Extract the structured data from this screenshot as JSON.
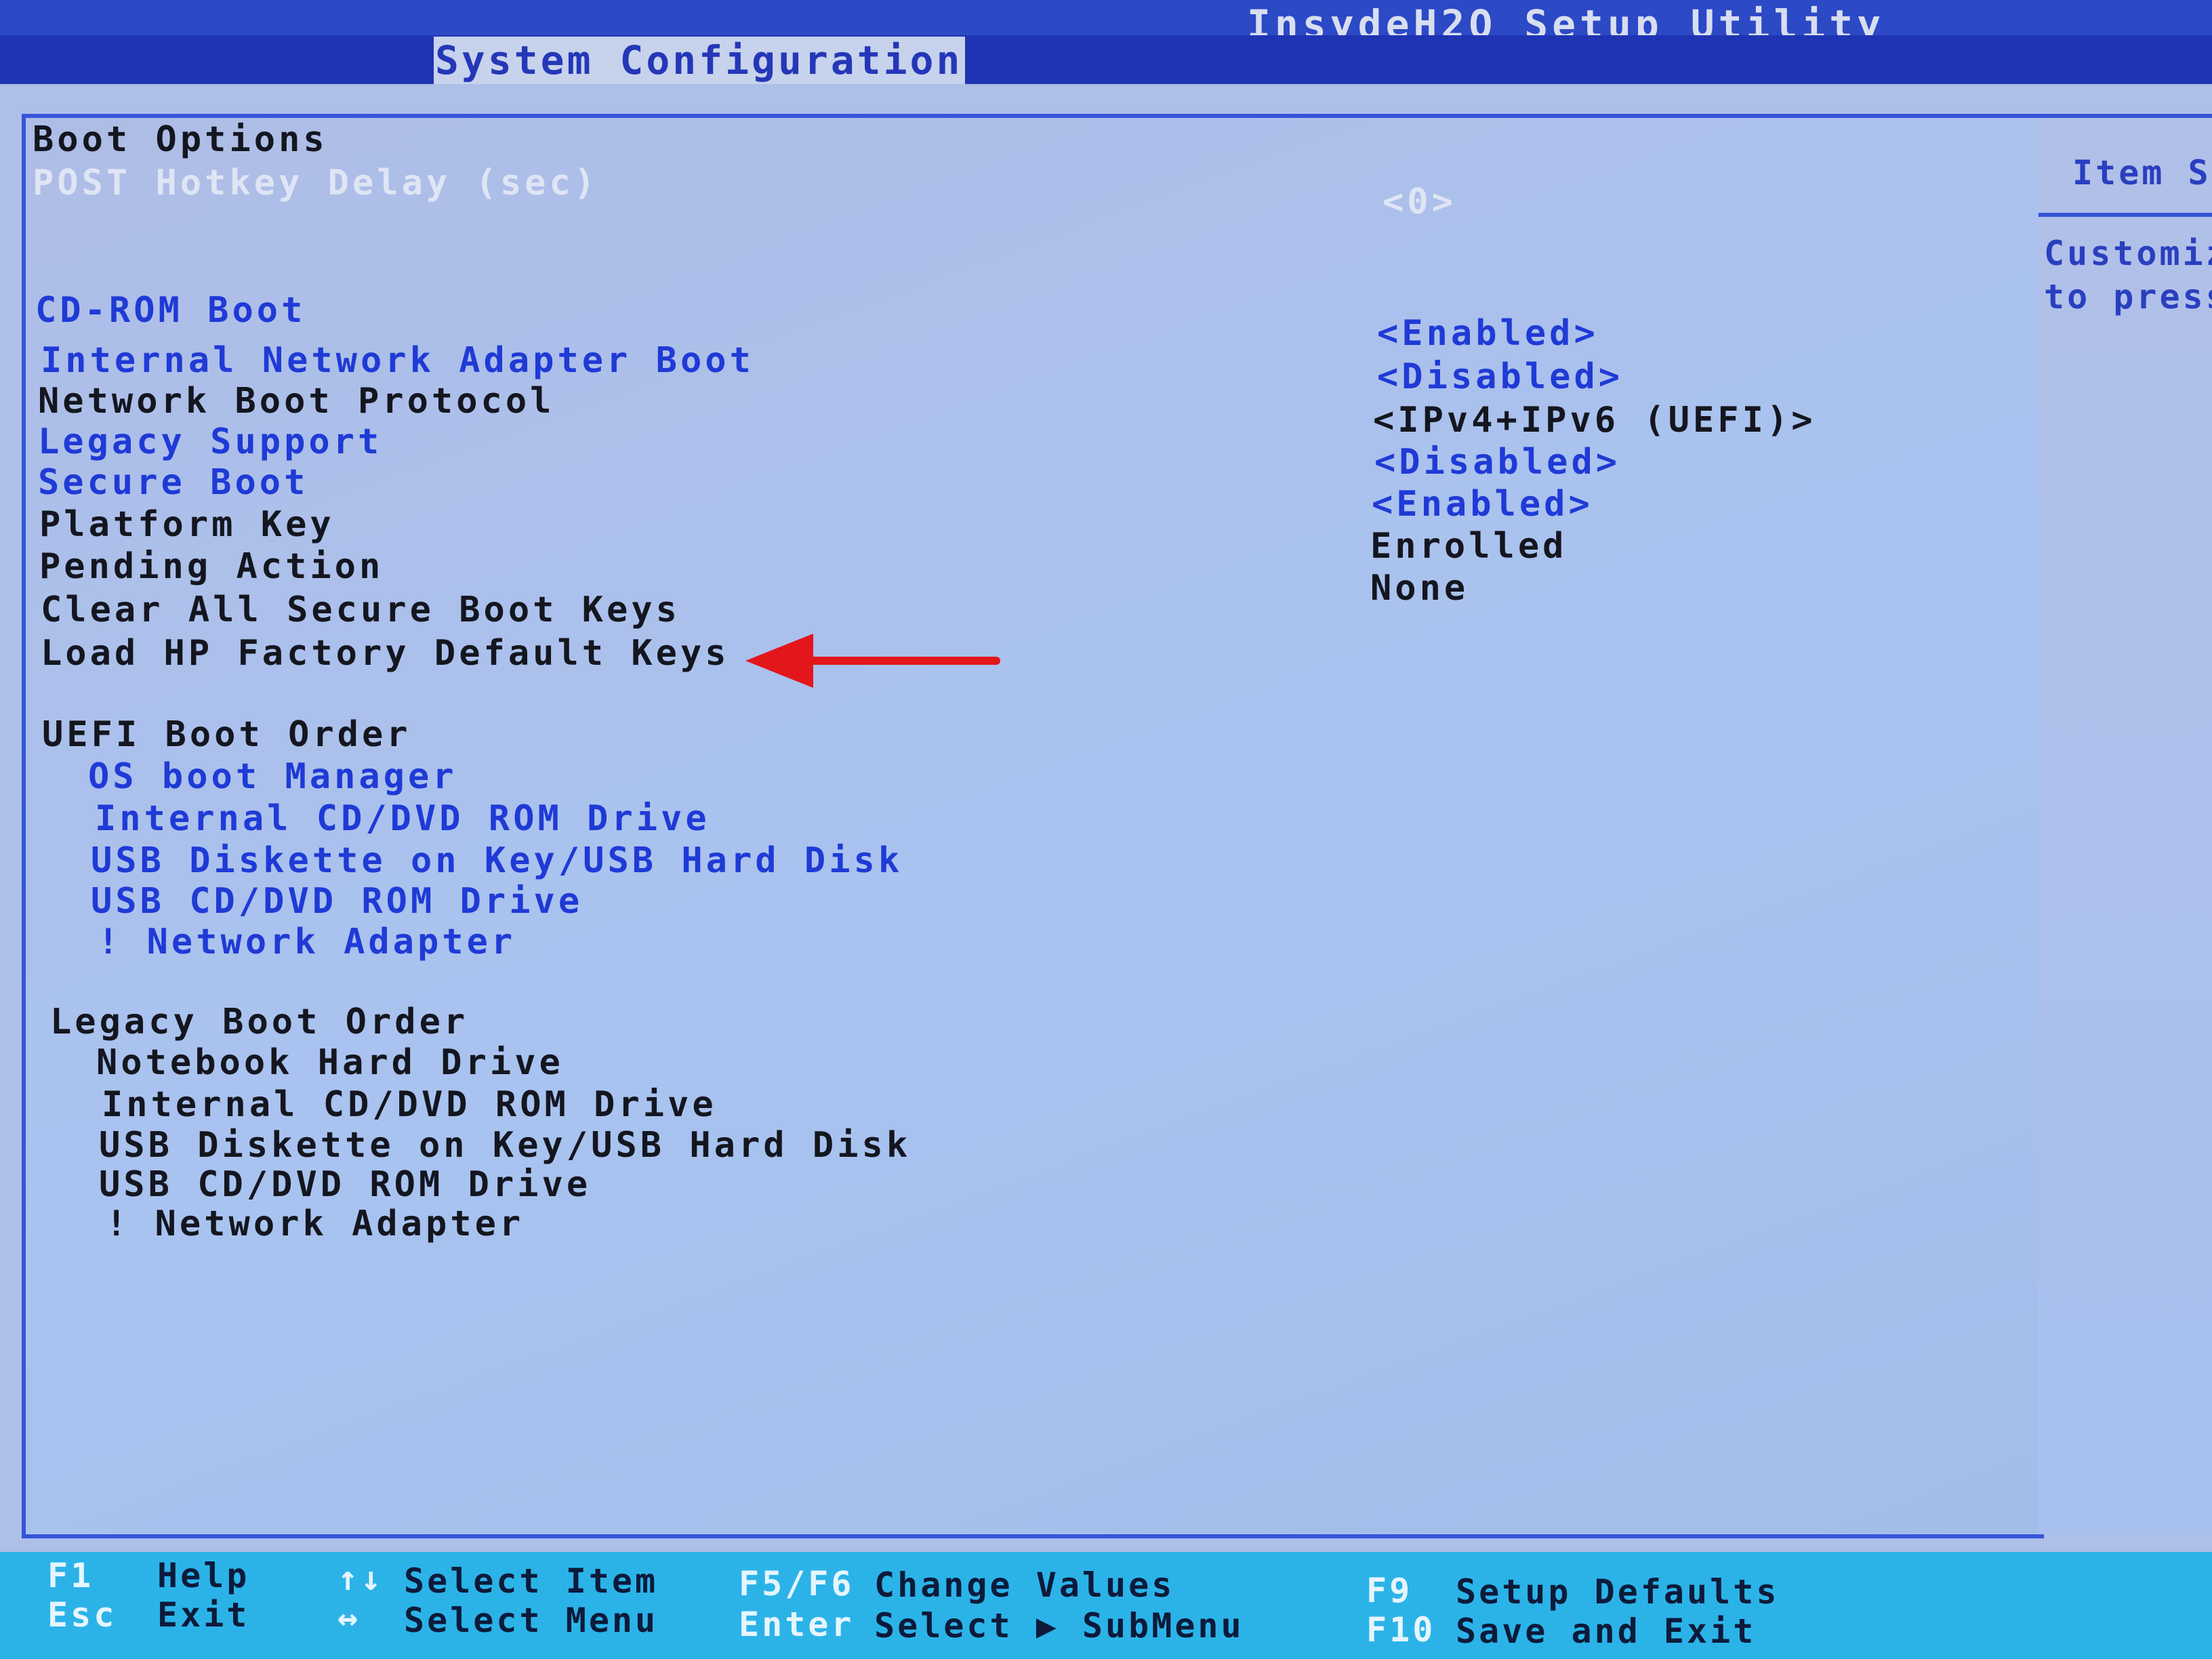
{
  "app_title": "InsydeH2O Setup Utility",
  "menu": {
    "active_tab": "System Configuration"
  },
  "section": {
    "title": "Boot Options"
  },
  "settings": [
    {
      "label": "POST Hotkey Delay (sec)",
      "value": "<0>"
    },
    {
      "label": "CD-ROM Boot",
      "value": "<Enabled>"
    },
    {
      "label": "Internal Network Adapter Boot",
      "value": "<Disabled>"
    },
    {
      "label": "Network Boot Protocol",
      "value": "<IPv4+IPv6 (UEFI)>"
    },
    {
      "label": "Legacy Support",
      "value": "<Disabled>"
    },
    {
      "label": "Secure Boot",
      "value": "<Enabled>"
    },
    {
      "label": "Platform Key",
      "value": "Enrolled"
    },
    {
      "label": "Pending Action",
      "value": "None"
    },
    {
      "label": "Clear All Secure Boot Keys"
    },
    {
      "label": "Load HP Factory Default Keys"
    }
  ],
  "uefi_boot_order": {
    "title": "UEFI Boot Order",
    "items": [
      "OS boot Manager",
      "Internal CD/DVD ROM Drive",
      "USB Diskette on Key/USB Hard Disk",
      "USB CD/DVD ROM Drive",
      "! Network Adapter"
    ]
  },
  "legacy_boot_order": {
    "title": "Legacy Boot Order",
    "items": [
      "Notebook Hard Drive",
      "Internal CD/DVD ROM Drive",
      "USB Diskette on Key/USB Hard Disk",
      "USB CD/DVD ROM Drive",
      "! Network Adapter"
    ]
  },
  "help_panel": {
    "title": "Item S",
    "text_line1": "Customiz",
    "text_line2": "to press"
  },
  "footer": [
    {
      "key": "F1",
      "desc": "Help"
    },
    {
      "key": "Esc",
      "desc": "Exit"
    },
    {
      "key": "↑↓",
      "desc": "Select Item"
    },
    {
      "key": "↔",
      "desc": "Select Menu"
    },
    {
      "key": "F5/F6",
      "desc": "Change Values"
    },
    {
      "key": "Enter",
      "desc": "Select ▶ SubMenu"
    },
    {
      "key": "F9",
      "desc": "Setup Defaults"
    },
    {
      "key": "F10",
      "desc": "Save and Exit"
    }
  ],
  "colors": {
    "background": "#aebfe8",
    "menu_bar": "#1f34b3",
    "footer": "#2bb3e8",
    "selectable_text": "#1f3ad6",
    "annotation_arrow": "#e3161b"
  }
}
